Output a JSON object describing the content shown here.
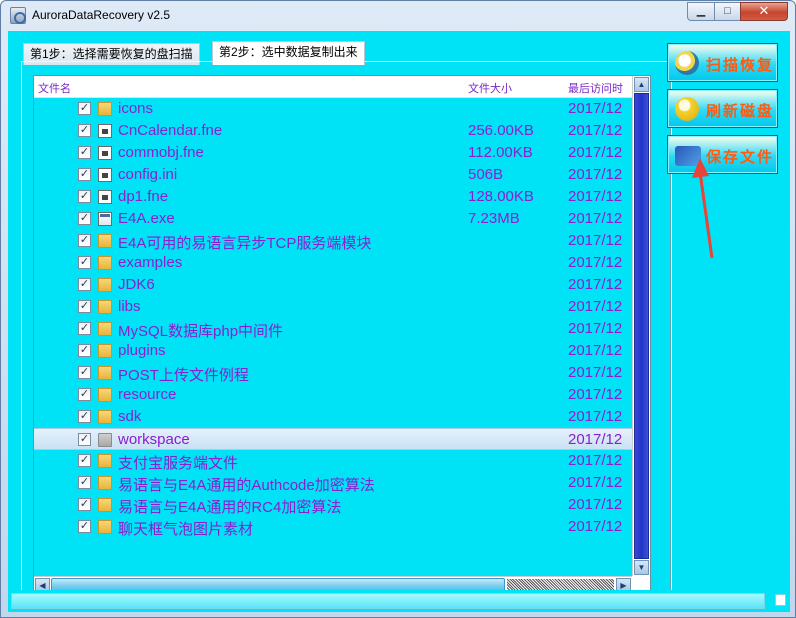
{
  "window": {
    "title": "AuroraDataRecovery v2.5",
    "controls": {
      "minimize": "▁",
      "maximize": "□",
      "close": "✕"
    }
  },
  "tabs": [
    {
      "label": "第1步：选择需要恢复的盘扫描"
    },
    {
      "label": "第2步：选中数据复制出来"
    }
  ],
  "list": {
    "columns": {
      "name": "文件名",
      "size": "文件大小",
      "date": "最后访问时"
    },
    "rows": [
      {
        "name": "icons",
        "size": "",
        "date": "2017/12",
        "icon": "folder-icon",
        "checked": "✓"
      },
      {
        "name": "CnCalendar.fne",
        "size": "256.00KB",
        "date": "2017/12",
        "icon": "file-icon",
        "checked": "✓"
      },
      {
        "name": "commobj.fne",
        "size": "112.00KB",
        "date": "2017/12",
        "icon": "file-icon",
        "checked": "✓"
      },
      {
        "name": "config.ini",
        "size": "506B",
        "date": "2017/12",
        "icon": "file-icon",
        "checked": "✓"
      },
      {
        "name": "dp1.fne",
        "size": "128.00KB",
        "date": "2017/12",
        "icon": "file-icon",
        "checked": "✓"
      },
      {
        "name": "E4A.exe",
        "size": "7.23MB",
        "date": "2017/12",
        "icon": "exe-icon",
        "checked": "✓"
      },
      {
        "name": "E4A可用的易语言异步TCP服务端模块",
        "size": "",
        "date": "2017/12",
        "icon": "folder-icon",
        "checked": "✓"
      },
      {
        "name": "examples",
        "size": "",
        "date": "2017/12",
        "icon": "folder-icon",
        "checked": "✓"
      },
      {
        "name": "JDK6",
        "size": "",
        "date": "2017/12",
        "icon": "folder-icon",
        "checked": "✓"
      },
      {
        "name": "libs",
        "size": "",
        "date": "2017/12",
        "icon": "folder-icon",
        "checked": "✓"
      },
      {
        "name": "MySQL数据库php中间件",
        "size": "",
        "date": "2017/12",
        "icon": "folder-icon",
        "checked": "✓"
      },
      {
        "name": "plugins",
        "size": "",
        "date": "2017/12",
        "icon": "folder-icon",
        "checked": "✓"
      },
      {
        "name": "POST上传文件例程",
        "size": "",
        "date": "2017/12",
        "icon": "folder-icon",
        "checked": "✓"
      },
      {
        "name": "resource",
        "size": "",
        "date": "2017/12",
        "icon": "folder-icon",
        "checked": "✓"
      },
      {
        "name": "sdk",
        "size": "",
        "date": "2017/12",
        "icon": "folder-icon",
        "checked": "✓"
      },
      {
        "name": "workspace",
        "size": "",
        "date": "2017/12",
        "icon": "folder-icon",
        "checked": "✓",
        "selected": true
      },
      {
        "name": "支付宝服务端文件",
        "size": "",
        "date": "2017/12",
        "icon": "folder-icon",
        "checked": "✓"
      },
      {
        "name": "易语言与E4A通用的Authcode加密算法",
        "size": "",
        "date": "2017/12",
        "icon": "folder-icon",
        "checked": "✓"
      },
      {
        "name": "易语言与E4A通用的RC4加密算法",
        "size": "",
        "date": "2017/12",
        "icon": "folder-icon",
        "checked": "✓"
      },
      {
        "name": "聊天框气泡图片素材",
        "size": "",
        "date": "2017/12",
        "icon": "folder-icon",
        "checked": "✓"
      }
    ]
  },
  "scroll": {
    "up": "▲",
    "down": "▼",
    "left": "◀",
    "right": "▶"
  },
  "side_buttons": {
    "scan": {
      "label": "扫描恢复",
      "icon": "magnifier-icon"
    },
    "refresh": {
      "label": "刷新磁盘",
      "icon": "refresh-icon"
    },
    "save": {
      "label": "保存文件",
      "icon": "save-icon"
    }
  },
  "colors": {
    "accent": "#00e3f7",
    "text": "#8a1ed0",
    "button_text": "#ff5a10",
    "arrow": "#e8443a"
  }
}
